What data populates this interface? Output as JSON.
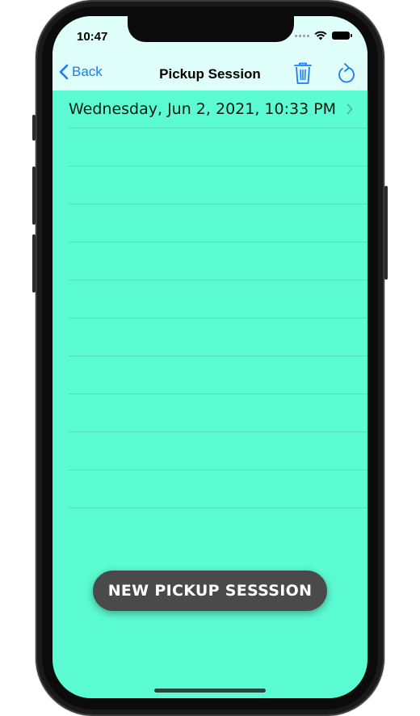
{
  "status_bar": {
    "time": "10:47"
  },
  "navbar": {
    "back_label": "Back",
    "title": "Pickup Session",
    "trash_icon": "trash-icon",
    "refresh_icon": "refresh-icon"
  },
  "sessions": [
    {
      "label": "Wednesday, Jun 2, 2021, 10:33 PM"
    }
  ],
  "fab": {
    "label": "NEW PICKUP SESSSION"
  },
  "colors": {
    "background": "#5cfcd2",
    "navbar": "#dffdf9",
    "accent": "#1a7cf7",
    "fab": "#4a4a4a"
  }
}
